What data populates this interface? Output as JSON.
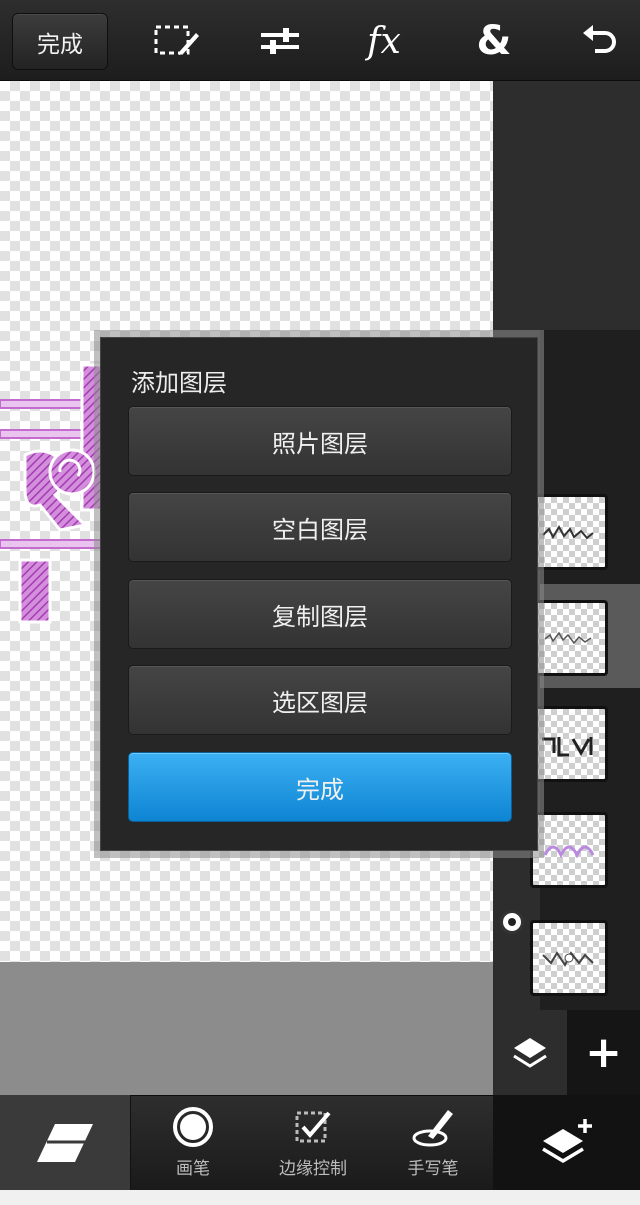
{
  "topbar": {
    "done_label": "完成",
    "icons": [
      "selection-edit-icon",
      "adjust-sliders-icon",
      "fx-icon",
      "blend-ampersand-icon",
      "undo-icon"
    ],
    "fx_text": "fx",
    "ampersand_text": "&"
  },
  "dialog": {
    "title": "添加图层",
    "buttons": [
      "照片图层",
      "空白图层",
      "复制图层",
      "选区图层"
    ],
    "done_label": "完成"
  },
  "bottombar": {
    "tools": [
      {
        "icon": "eraser-icon",
        "label": ""
      },
      {
        "icon": "brush-circle-icon",
        "label": "画笔"
      },
      {
        "icon": "edge-control-icon",
        "label": "边缘控制"
      },
      {
        "icon": "stylus-icon",
        "label": "手写笔"
      }
    ],
    "add_layer_icon": "add-layer-icon"
  },
  "layers": {
    "count": 5,
    "selected_index": 1
  },
  "colors": {
    "accent_blue": "#1a96e3",
    "toolbar_dark": "#1d1d1d",
    "art_pink": "#c46bd0"
  }
}
